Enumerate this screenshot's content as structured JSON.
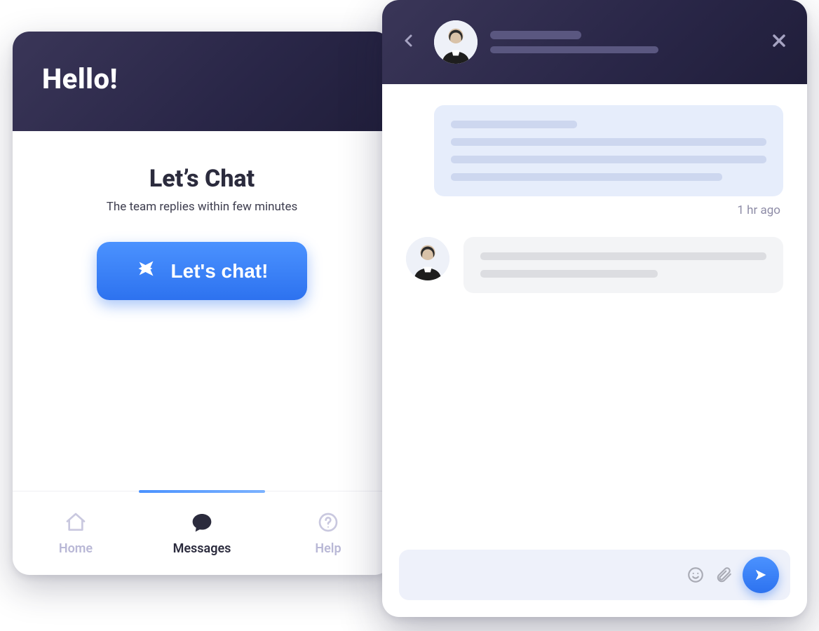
{
  "left": {
    "greeting": "Hello!",
    "title": "Let’s Chat",
    "subtitle": "The team replies within few minutes",
    "cta_label": "Let's chat!"
  },
  "nav": {
    "items": [
      {
        "key": "home",
        "label": "Home",
        "icon": "home-icon",
        "active": false
      },
      {
        "key": "messages",
        "label": "Messages",
        "icon": "chat-bubble-icon",
        "active": true
      },
      {
        "key": "help",
        "label": "Help",
        "icon": "question-circle-icon",
        "active": false
      }
    ]
  },
  "chat": {
    "header": {
      "avatar": "agent-avatar",
      "title_placeholder_widths": [
        130,
        240
      ]
    },
    "messages": [
      {
        "type": "outgoing",
        "skeleton_line_widths": [
          180,
          430,
          430,
          370
        ],
        "bubble_style": "blue",
        "timestamp": "1 hr ago"
      },
      {
        "type": "incoming",
        "avatar": "agent-avatar",
        "skeleton_line_widths": [
          400,
          250
        ],
        "bubble_style": "gray"
      }
    ],
    "input": {
      "placeholder": "",
      "value": ""
    }
  },
  "colors": {
    "accent_blue": "#2d72ef",
    "header_dark": "#292647",
    "bubble_out": "#e6edfb",
    "bubble_in": "#f3f4f6"
  }
}
